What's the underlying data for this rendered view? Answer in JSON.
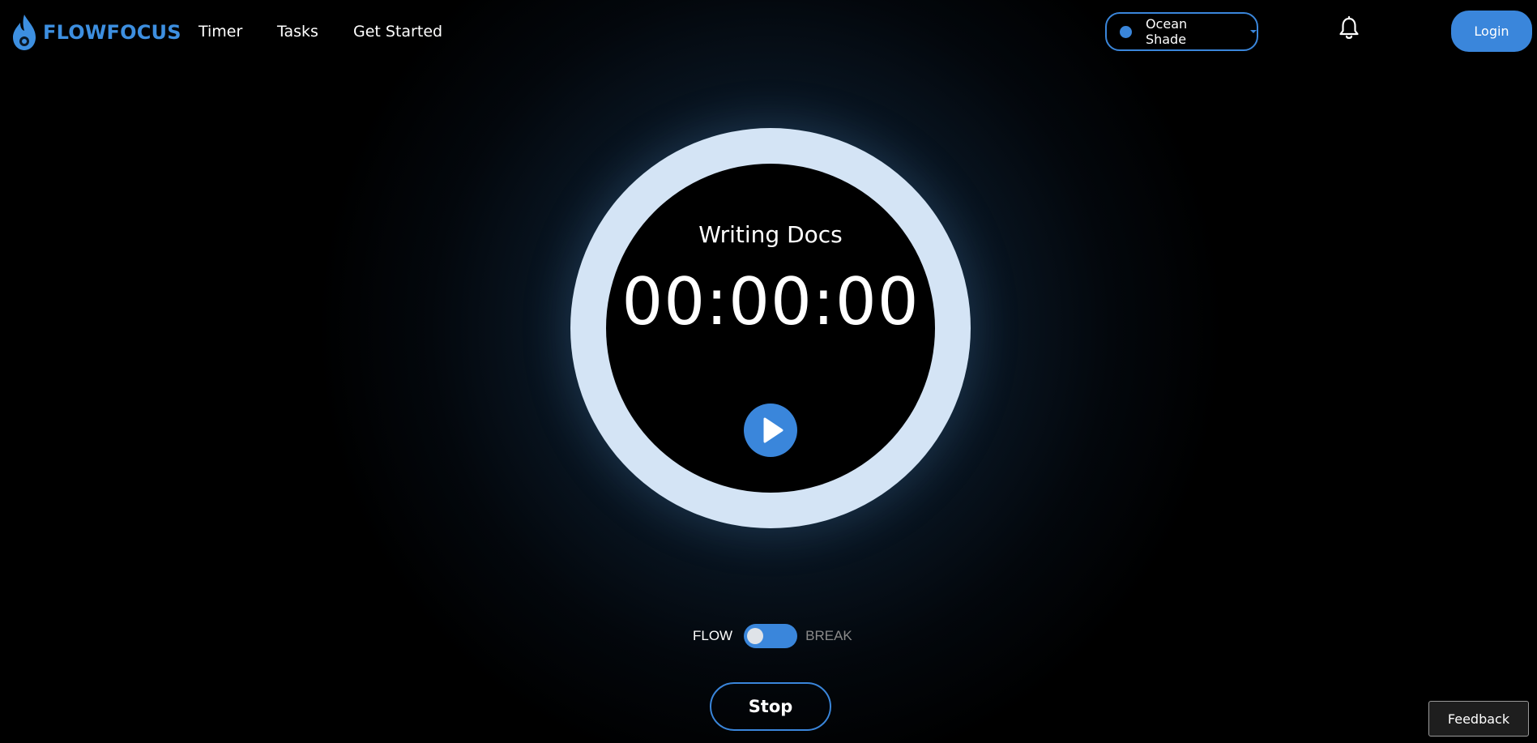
{
  "brand": {
    "name": "FLOWFOCUS",
    "icon": "flame-icon",
    "color": "#3d8fe0"
  },
  "nav": {
    "links": [
      {
        "label": "Timer"
      },
      {
        "label": "Tasks"
      },
      {
        "label": "Get Started"
      }
    ]
  },
  "theme": {
    "selected": "Ocean Shade",
    "accent": "#3a86db"
  },
  "header": {
    "notifications_icon": "bell-icon",
    "login_label": "Login"
  },
  "timer": {
    "task_name": "Writing Docs",
    "time": "00:00:00",
    "play_icon": "play-icon",
    "ring_color": "#d4e4f5"
  },
  "mode": {
    "flow_label": "FLOW",
    "break_label": "BREAK",
    "is_break": false
  },
  "controls": {
    "stop_label": "Stop"
  },
  "feedback": {
    "label": "Feedback"
  }
}
